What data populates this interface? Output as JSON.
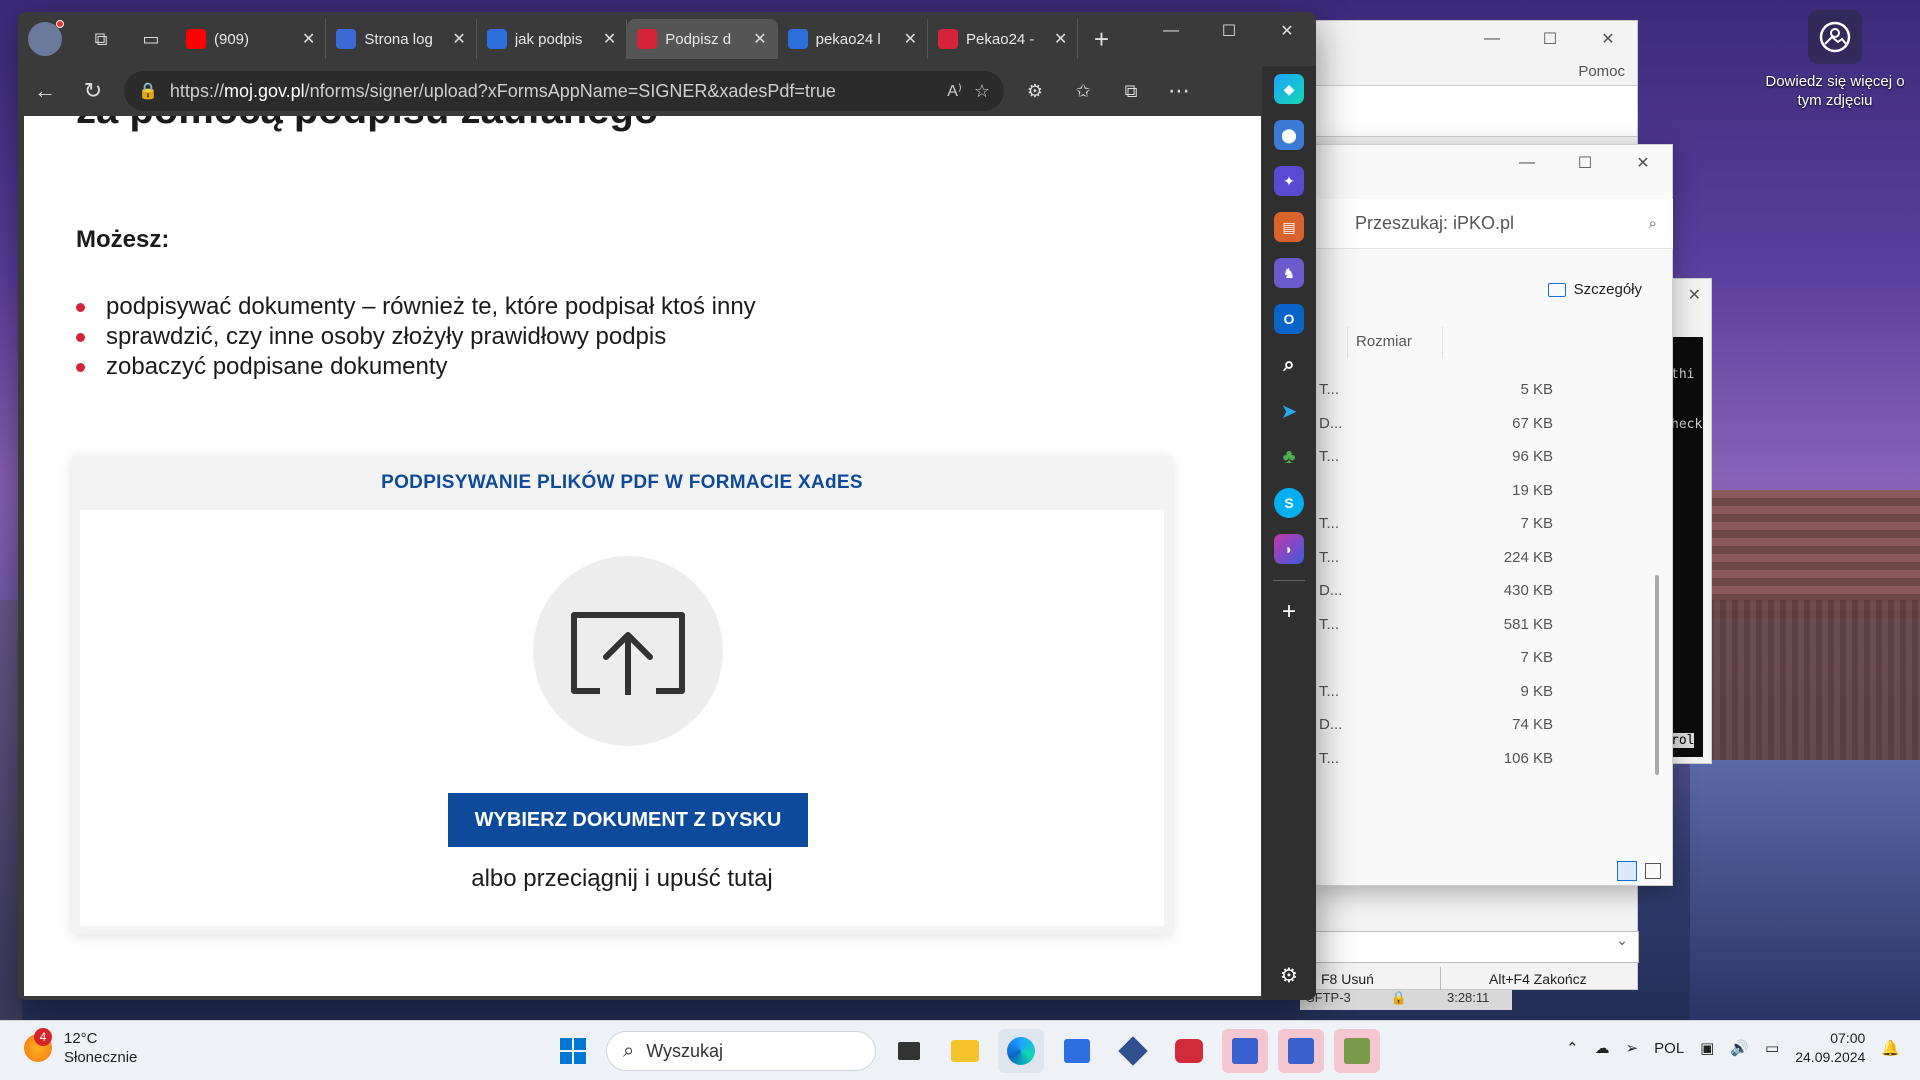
{
  "desktop": {
    "photo_label": "Dowiedz się więcej o tym zdjęciu"
  },
  "browser": {
    "tabs": [
      {
        "title": "(909)",
        "favicon": "youtube-icon",
        "color": "#ff0000",
        "active": false
      },
      {
        "title": "Strona log",
        "favicon": "person-icon",
        "color": "#3a6ad4",
        "active": false
      },
      {
        "title": "jak podpis",
        "favicon": "search-icon",
        "color": "#2a6fdb",
        "active": false
      },
      {
        "title": "Podpisz d",
        "favicon": "eagle-icon",
        "color": "#d5233a",
        "active": true
      },
      {
        "title": "pekao24 l",
        "favicon": "search-icon",
        "color": "#2a6fdb",
        "active": false
      },
      {
        "title": "Pekao24 -",
        "favicon": "pekao-icon",
        "color": "#d5233a",
        "active": false
      }
    ],
    "url_scheme": "https://",
    "url_host": "moj.gov.pl",
    "url_rest": "/nforms/signer/upload?xFormsAppName=SIGNER&xadesPdf=true"
  },
  "page": {
    "heading": "za pomocą podpisu zaufanego",
    "can_label": "Możesz:",
    "bullets": [
      "podpisywać dokumenty – również te, które podpisał ktoś inny",
      "sprawdzić, czy inne osoby złożyły prawidłowy podpis",
      "zobaczyć podpisane dokumenty"
    ],
    "card_title": "PODPISYWANIE PLIKÓW PDF W FORMACIE XAdES",
    "choose_button": "WYBIERZ DOKUMENT Z DYSKU",
    "drag_text": "albo przeciągnij i upuść tutaj"
  },
  "background_windows": {
    "help_menu": "Pomoc",
    "f8": "F8 Usuń",
    "altf4": "Alt+F4 Zakończ",
    "sftp": "SFTP-3",
    "time": "3:28:11",
    "terminal_lines": [
      "thi",
      "heck",
      "rol"
    ]
  },
  "explorer": {
    "search_placeholder": "Przeszukaj: iPKO.pl",
    "details_label": "Szczegóły",
    "size_column": "Rozmiar",
    "rows": [
      {
        "name": "T...",
        "size": "5 KB"
      },
      {
        "name": "D...",
        "size": "67 KB"
      },
      {
        "name": "T...",
        "size": "96 KB"
      },
      {
        "name": "",
        "size": "19 KB"
      },
      {
        "name": "T...",
        "size": "7 KB"
      },
      {
        "name": "T...",
        "size": "224 KB"
      },
      {
        "name": "D...",
        "size": "430 KB"
      },
      {
        "name": "T...",
        "size": "581 KB"
      },
      {
        "name": "",
        "size": "7 KB"
      },
      {
        "name": "T...",
        "size": "9 KB"
      },
      {
        "name": "D...",
        "size": "74 KB"
      },
      {
        "name": "T...",
        "size": "106 KB"
      }
    ]
  },
  "taskbar": {
    "weather_badge": "4",
    "temperature": "12°C",
    "condition": "Słonecznie",
    "search_placeholder": "Wyszukaj",
    "language": "POL",
    "time": "07:00",
    "date": "24.09.2024"
  }
}
